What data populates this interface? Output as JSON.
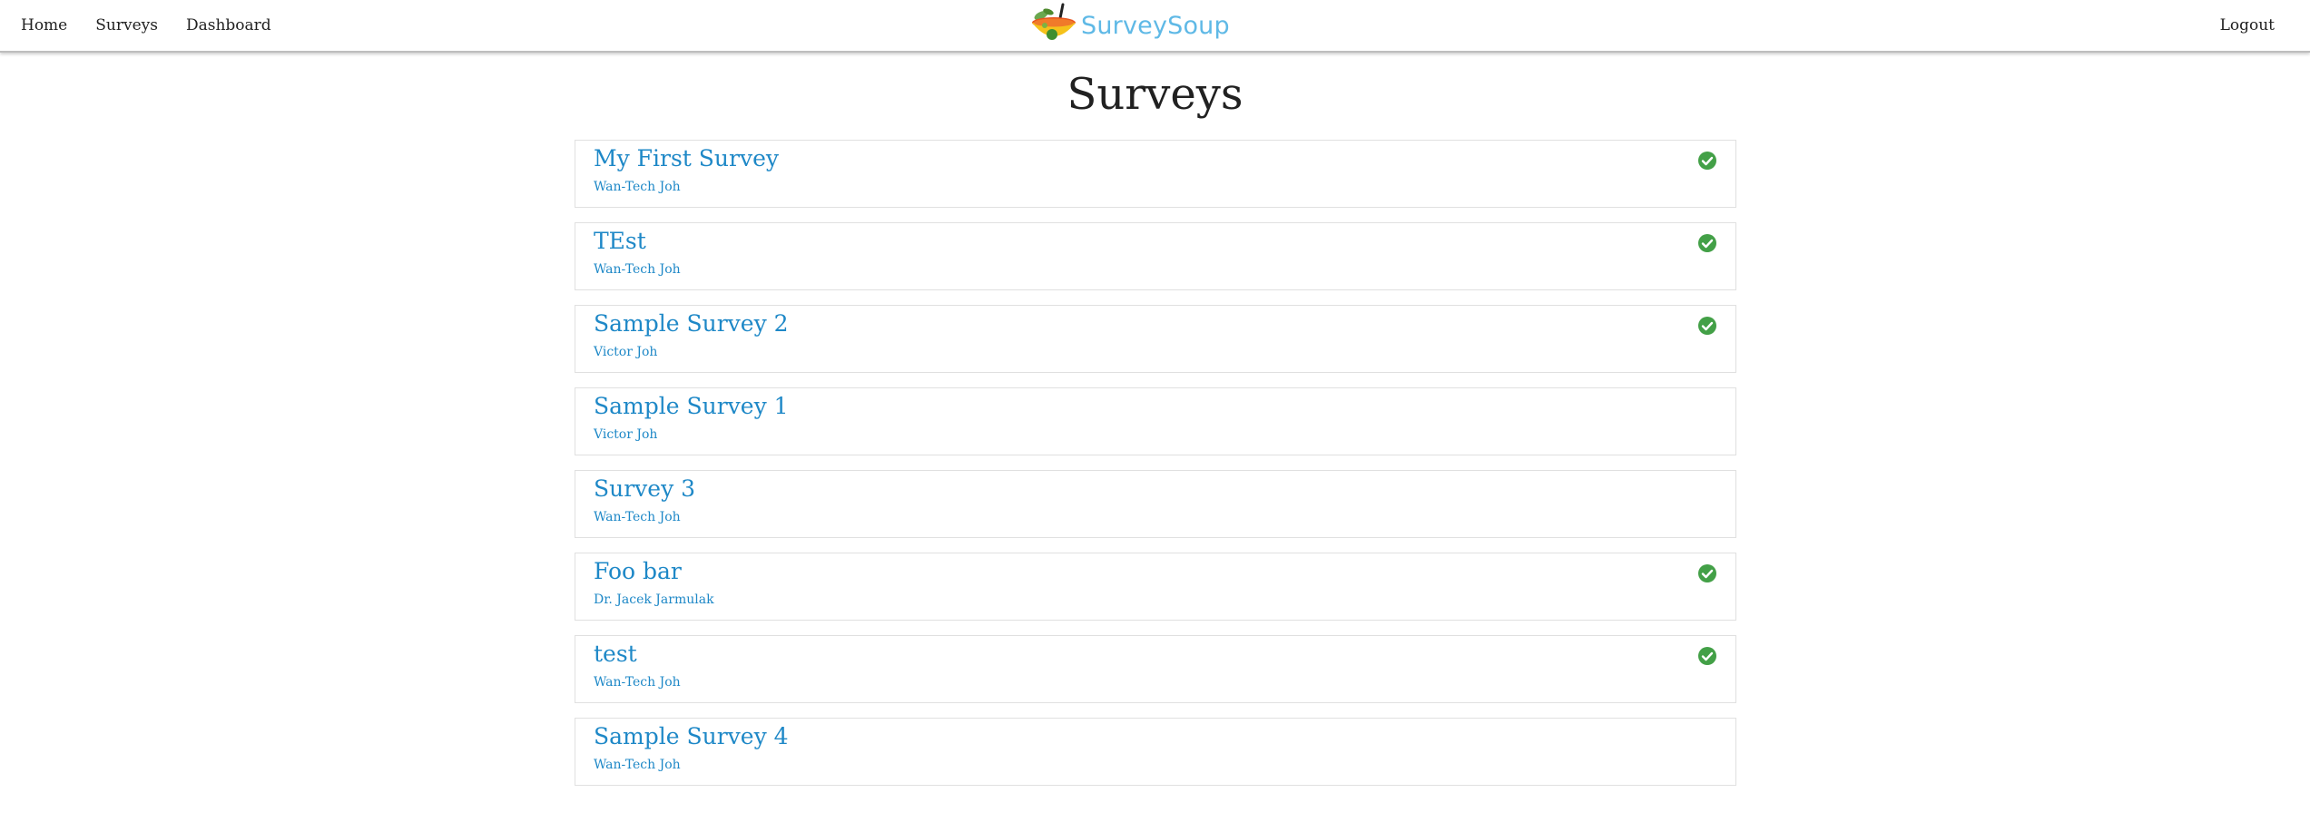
{
  "nav": {
    "links": [
      {
        "label": "Home"
      },
      {
        "label": "Surveys"
      },
      {
        "label": "Dashboard"
      }
    ],
    "logout_label": "Logout",
    "brand_name": "SurveySoup",
    "brand_logo_icon": "soup-bowl-icon"
  },
  "page": {
    "title": "Surveys"
  },
  "colors": {
    "link_blue": "#1e88c7",
    "brand_blue": "#5fb9e6",
    "check_green": "#43a047"
  },
  "surveys": [
    {
      "title": "My First Survey",
      "author": "Wan-Tech Joh",
      "completed": true
    },
    {
      "title": "TEst",
      "author": "Wan-Tech Joh",
      "completed": true
    },
    {
      "title": "Sample Survey 2",
      "author": "Victor Joh",
      "completed": true
    },
    {
      "title": "Sample Survey 1",
      "author": "Victor Joh",
      "completed": false
    },
    {
      "title": "Survey 3",
      "author": "Wan-Tech Joh",
      "completed": false
    },
    {
      "title": "Foo bar",
      "author": "Dr. Jacek Jarmulak",
      "completed": true
    },
    {
      "title": "test",
      "author": "Wan-Tech Joh",
      "completed": true
    },
    {
      "title": "Sample Survey 4",
      "author": "Wan-Tech Joh",
      "completed": false
    }
  ]
}
